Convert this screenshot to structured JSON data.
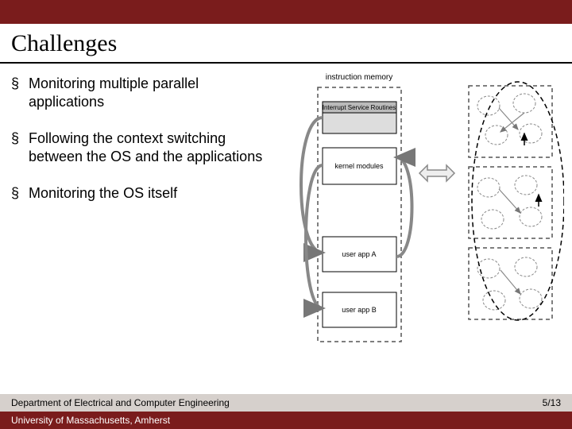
{
  "title": "Challenges",
  "bullets": [
    "Monitoring multiple parallel applications",
    "Following the context switching between the OS and the applications",
    "Monitoring the OS itself"
  ],
  "diagram": {
    "header": "instruction memory",
    "blocks": {
      "isr": "Interrupt Service Routines",
      "kernel": "kernel modules",
      "app_a": "user app A",
      "app_b": "user app B"
    }
  },
  "footer": {
    "department": "Department of Electrical and Computer Engineering",
    "university": "University of Massachusetts, Amherst",
    "page": "5/13"
  }
}
